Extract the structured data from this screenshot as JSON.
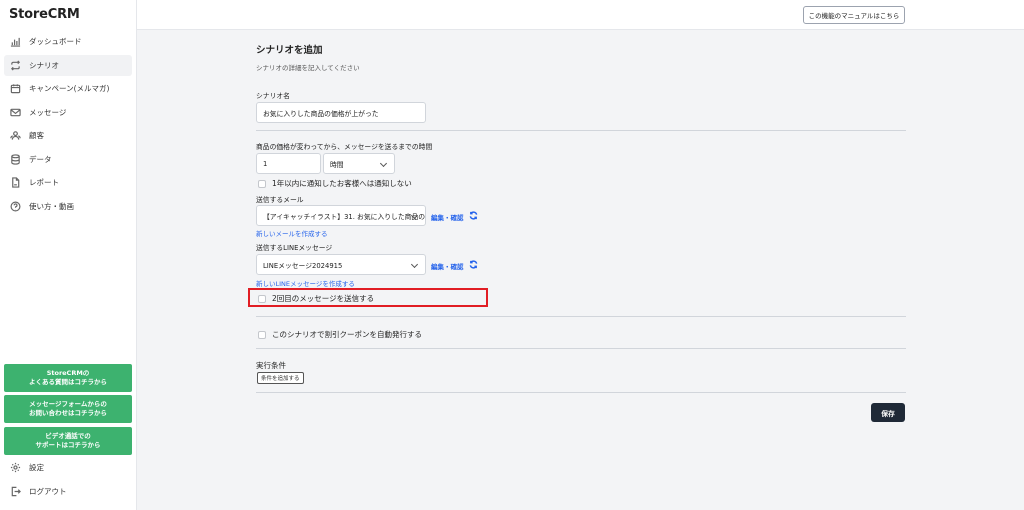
{
  "app": {
    "name": "StoreCRM"
  },
  "sidebar": {
    "items": [
      {
        "label": "ダッシュボード",
        "icon": "bar-chart-icon",
        "active": false
      },
      {
        "label": "シナリオ",
        "icon": "repeat-icon",
        "active": true
      },
      {
        "label": "キャンペーン(メルマガ)",
        "icon": "calendar-icon",
        "active": false
      },
      {
        "label": "メッセージ",
        "icon": "mail-icon",
        "active": false
      },
      {
        "label": "顧客",
        "icon": "users-icon",
        "active": false
      },
      {
        "label": "データ",
        "icon": "database-icon",
        "active": false
      },
      {
        "label": "レポート",
        "icon": "file-icon",
        "active": false
      },
      {
        "label": "使い方・動画",
        "icon": "question-icon",
        "active": false
      }
    ],
    "help_buttons": [
      "StoreCRMの\nよくある質問はコチラから",
      "メッセージフォームからの\nお問い合わせはコチラから",
      "ビデオ通話での\nサポートはコチラから"
    ],
    "bottom_items": [
      {
        "label": "設定",
        "icon": "gear-icon"
      },
      {
        "label": "ログアウト",
        "icon": "logout-icon"
      }
    ],
    "help_color": "#3db26f"
  },
  "topbar": {
    "manual_button": "この機能のマニュアルはこちら"
  },
  "form": {
    "title": "シナリオを追加",
    "subtitle": "シナリオの詳細を記入してください",
    "name_label": "シナリオ名",
    "name_value": "お気に入りした商品の価格が上がった",
    "wait_label": "商品の価格が変わってから、メッセージを送るまでの時間",
    "wait_value": "1",
    "wait_unit": "時間",
    "no_notify_label": "1年以内に通知したお客様へは通知しない",
    "mail_label": "送信するメール",
    "mail_value": "【アイキャッチイラスト】31. お気に入りした商品の値",
    "mail_edit": "編集・確認",
    "new_mail_link": "新しいメールを作成する",
    "line_label": "送信するLINEメッセージ",
    "line_value": "LINEメッセージ2024915",
    "line_edit": "編集・確認",
    "new_line_link": "新しいLINEメッセージを作成する",
    "second_message_label": "2回目のメッセージを送信する",
    "coupon_label": "このシナリオで割引クーポンを自動発行する",
    "conditions_label": "実行条件",
    "add_condition_button": "条件を追加する",
    "save_button": "保存"
  },
  "colors": {
    "link": "#2563eb",
    "highlight": "#e11d24",
    "save": "#1f2937"
  }
}
